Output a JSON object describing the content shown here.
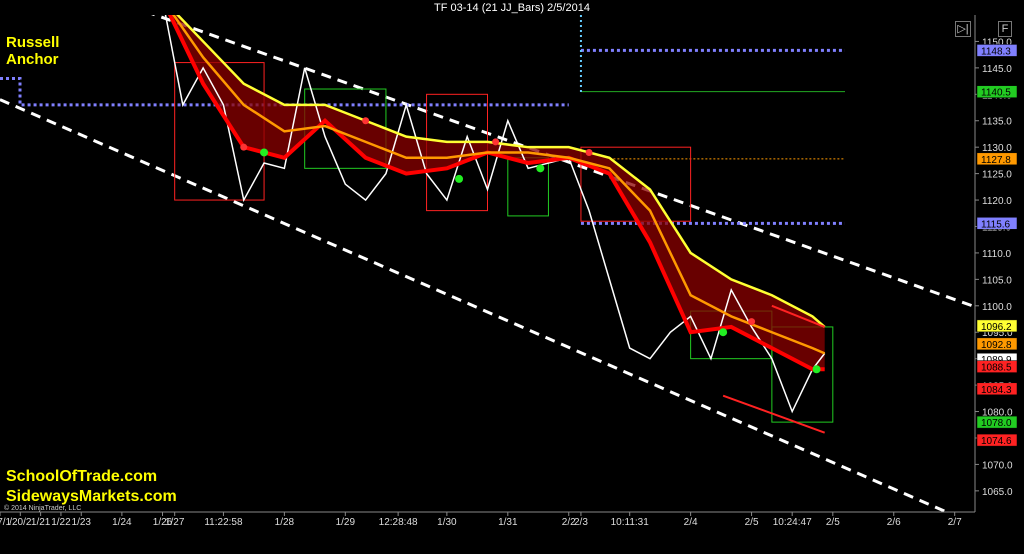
{
  "window": {
    "title": "TF 03-14 (21 JJ_Bars)  2/5/2014"
  },
  "overlay": {
    "label_line1": "Russell",
    "label_line2": "Anchor",
    "watermark1": "SchoolOfTrade.com",
    "watermark2": "SidewaysMarkets.com",
    "copyright": "© 2014 NinjaTrader, LLC"
  },
  "controls": {
    "nav": "▷|",
    "float": "F"
  },
  "colors": {
    "background": "#000000",
    "ema_fast": "#ff0000",
    "ema_mid": "#ff9900",
    "ema_slow": "#ffff33",
    "price": "#ffffff",
    "channel": "#ffffff",
    "box_red": "#ff2222",
    "box_green": "#22cc22",
    "level_blue": "#8080ff",
    "level_green": "#22aa22"
  },
  "chart_data": {
    "type": "line",
    "symbol": "TF 03-14",
    "bar_type": "21 JJ_Bars",
    "date": "2/5/2014",
    "ylim": [
      1061,
      1155
    ],
    "y_ticks": [
      1065,
      1070,
      1075,
      1080,
      1085,
      1090,
      1095,
      1100,
      1105,
      1110,
      1115,
      1120,
      1125,
      1130,
      1135,
      1140,
      1145,
      1150
    ],
    "x_tick_labels": [
      "/17/1",
      "/20/2",
      "1/21",
      "1/22",
      "1/23",
      "1/24",
      "1/26",
      "1/27",
      "11:22:58",
      "1/28",
      "1/29",
      "12:28:48",
      "1/30",
      "1/31",
      "2/2",
      "2/3",
      "10:11:31",
      "2/4",
      "2/5",
      "10:24:47",
      "2/5",
      "2/6",
      "2/7"
    ],
    "x_tick_positions": [
      0,
      0.5,
      1,
      1.5,
      2,
      3,
      4,
      4.3,
      5.5,
      7,
      8.5,
      9.8,
      11,
      12.5,
      14,
      14.3,
      15.5,
      17,
      18.5,
      19.5,
      20.5,
      22,
      23.5
    ],
    "series": [
      {
        "x": [
          4,
          4.5,
          5,
          5.5,
          6,
          6.5,
          7,
          7.5,
          8,
          8.5,
          9,
          9.5,
          10,
          10.5,
          11,
          11.5,
          12,
          12.5,
          13,
          13.5,
          14,
          14.5,
          15,
          15.5,
          16,
          16.5,
          17,
          17.5,
          18,
          18.5,
          19,
          19.5,
          20,
          20.3
        ],
        "y": [
          1158,
          1138,
          1145,
          1138,
          1120,
          1127,
          1126,
          1145,
          1132,
          1123,
          1120,
          1125,
          1138,
          1125,
          1120,
          1132,
          1122,
          1135,
          1126,
          1127,
          1128,
          1118,
          1105,
          1092,
          1090,
          1095,
          1098,
          1090,
          1103,
          1096,
          1090,
          1080,
          1088,
          1091
        ]
      },
      {
        "x": [
          4,
          5,
          6,
          7,
          8,
          9,
          10,
          11,
          12,
          13,
          14,
          15,
          16,
          17,
          18,
          19,
          20,
          20.3
        ],
        "y": [
          1158,
          1142,
          1130,
          1128,
          1135,
          1128,
          1125,
          1126,
          1129,
          1127,
          1128,
          1125,
          1112,
          1095,
          1096,
          1092,
          1088,
          1088
        ]
      },
      {
        "x": [
          4,
          5,
          6,
          7,
          8,
          9,
          10,
          11,
          12,
          13,
          14,
          15,
          16,
          17,
          18,
          19,
          20,
          20.3
        ],
        "y": [
          1158,
          1147,
          1138,
          1133,
          1134,
          1131,
          1128,
          1128,
          1129,
          1129,
          1128,
          1126,
          1118,
          1102,
          1098,
          1095,
          1092,
          1091
        ]
      },
      {
        "x": [
          4,
          5,
          6,
          7,
          8,
          9,
          10,
          11,
          12,
          13,
          14,
          15,
          16,
          17,
          18,
          19,
          20,
          20.3
        ],
        "y": [
          1158,
          1150,
          1142,
          1138,
          1138,
          1135,
          1132,
          1131,
          1131,
          1130,
          1130,
          1128,
          1122,
          1110,
          1105,
          1102,
          1098,
          1096
        ]
      }
    ],
    "green_dots": [
      {
        "x": 6.5,
        "y": 1129
      },
      {
        "x": 11.3,
        "y": 1124
      },
      {
        "x": 13.3,
        "y": 1126
      },
      {
        "x": 17.8,
        "y": 1095
      },
      {
        "x": 20.1,
        "y": 1088
      }
    ],
    "red_dots": [
      {
        "x": 6,
        "y": 1130
      },
      {
        "x": 9,
        "y": 1135
      },
      {
        "x": 12.2,
        "y": 1131
      },
      {
        "x": 14.5,
        "y": 1129
      },
      {
        "x": 18.5,
        "y": 1097
      }
    ],
    "levels": [
      {
        "value": 1148.3,
        "label": "1148.3",
        "color": "#8080ff"
      },
      {
        "value": 1140.5,
        "label": "1140.5",
        "color": "#22cc22"
      },
      {
        "value": 1127.8,
        "label": "1127.8",
        "color": "#ff9900"
      },
      {
        "value": 1115.6,
        "label": "1115.6",
        "color": "#8080ff"
      },
      {
        "value": 1096.2,
        "label": "1096.2",
        "color": "#ffff33"
      },
      {
        "value": 1092.8,
        "label": "1092.8",
        "color": "#ff9900"
      },
      {
        "value": 1089.9,
        "label": "1089.9",
        "color": "#ffffff"
      },
      {
        "value": 1088.5,
        "label": "1088.5",
        "color": "#ff2222"
      },
      {
        "value": 1084.3,
        "label": "1084.3",
        "color": "#ff2222"
      },
      {
        "value": 1078.0,
        "label": "1078.0",
        "color": "#22cc22"
      },
      {
        "value": 1074.6,
        "label": "1074.6",
        "color": "#ff2222"
      }
    ],
    "channel_upper": [
      [
        2,
        1160
      ],
      [
        24.3,
        1099
      ]
    ],
    "channel_lower": [
      [
        0,
        1139
      ],
      [
        23.3,
        1061
      ]
    ],
    "grid": false,
    "y_axis_position": "right"
  }
}
